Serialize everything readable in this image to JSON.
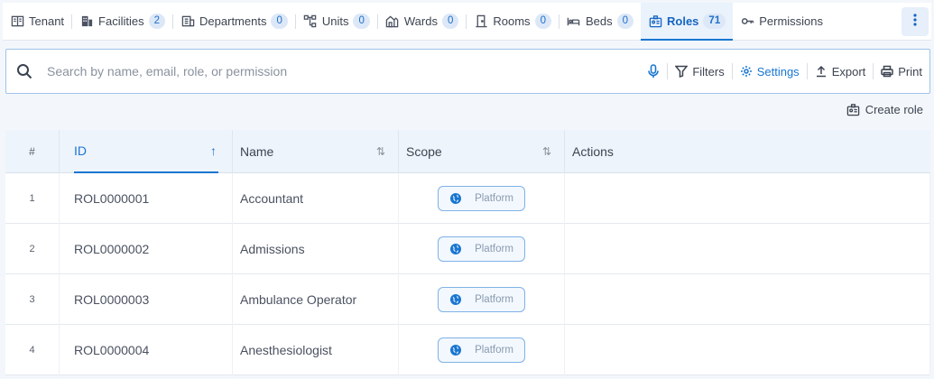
{
  "tabs": [
    {
      "label": "Tenant",
      "icon": "tenant-icon"
    },
    {
      "label": "Facilities",
      "count": "2",
      "icon": "facilities-icon"
    },
    {
      "label": "Departments",
      "count": "0",
      "icon": "departments-icon"
    },
    {
      "label": "Units",
      "count": "0",
      "icon": "units-icon"
    },
    {
      "label": "Wards",
      "count": "0",
      "icon": "wards-icon"
    },
    {
      "label": "Rooms",
      "count": "0",
      "icon": "rooms-icon"
    },
    {
      "label": "Beds",
      "count": "0",
      "icon": "beds-icon"
    },
    {
      "label": "Roles",
      "count": "71",
      "icon": "roles-icon",
      "active": true
    },
    {
      "label": "Permissions",
      "icon": "key-icon"
    }
  ],
  "search": {
    "placeholder": "Search by name, email, role, or permission",
    "value": ""
  },
  "toolbar": {
    "filters": "Filters",
    "settings": "Settings",
    "export": "Export",
    "print": "Print"
  },
  "create_role": "Create role",
  "table": {
    "columns": {
      "num": "#",
      "id": "ID",
      "name": "Name",
      "scope": "Scope",
      "actions": "Actions"
    },
    "rows": [
      {
        "num": "1",
        "id": "ROL0000001",
        "name": "Accountant",
        "scope": "Platform"
      },
      {
        "num": "2",
        "id": "ROL0000002",
        "name": "Admissions",
        "scope": "Platform"
      },
      {
        "num": "3",
        "id": "ROL0000003",
        "name": "Ambulance Operator",
        "scope": "Platform"
      },
      {
        "num": "4",
        "id": "ROL0000004",
        "name": "Anesthesiologist",
        "scope": "Platform"
      }
    ]
  },
  "colors": {
    "accent": "#1976d2",
    "background": "#f3f7fb",
    "header_bg": "#eef4fb"
  }
}
